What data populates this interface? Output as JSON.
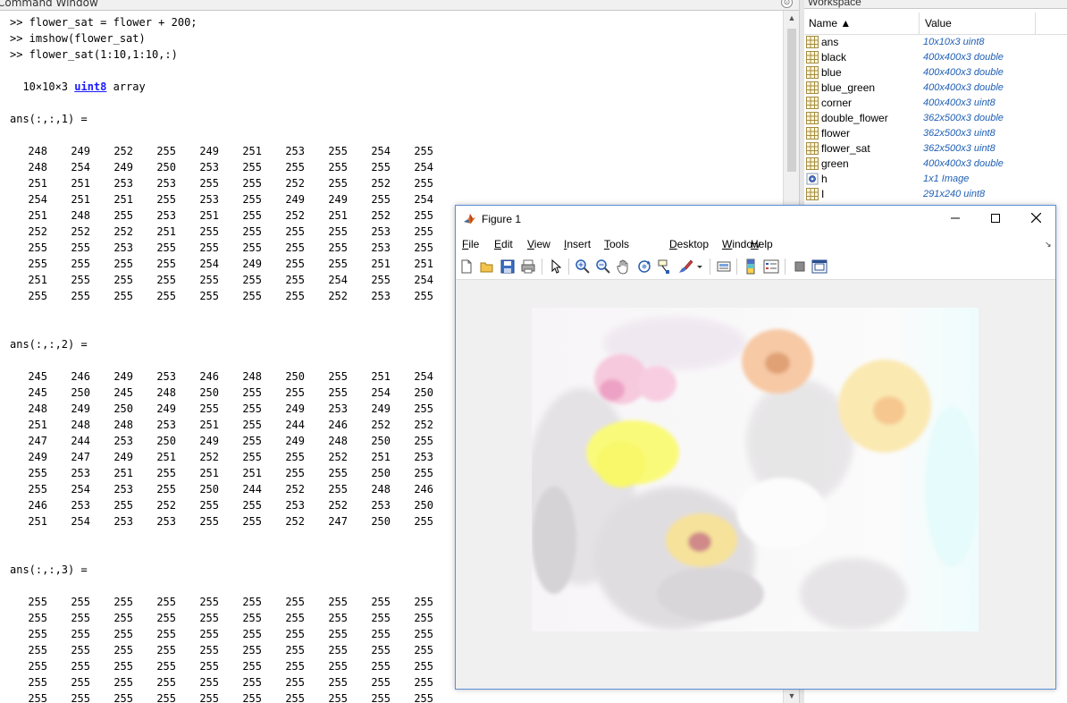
{
  "command_window": {
    "title": "Command Window",
    "commands": [
      ">> flower_sat = flower + 200;",
      ">> imshow(flower_sat)",
      ">> flower_sat(1:10,1:10,:)"
    ],
    "array_info": {
      "prefix": "  10×10×3 ",
      "class_link": "uint8",
      "suffix": " array"
    },
    "slices": [
      {
        "header": "ans(:,:,1) =",
        "rows": [
          [
            248,
            249,
            252,
            255,
            249,
            251,
            253,
            255,
            254,
            255
          ],
          [
            248,
            254,
            249,
            250,
            253,
            255,
            255,
            255,
            255,
            254
          ],
          [
            251,
            251,
            253,
            253,
            255,
            255,
            252,
            255,
            252,
            255
          ],
          [
            254,
            251,
            251,
            255,
            253,
            255,
            249,
            249,
            255,
            254
          ],
          [
            251,
            248,
            255,
            253,
            251,
            255,
            252,
            251,
            252,
            255
          ],
          [
            252,
            252,
            252,
            251,
            255,
            255,
            255,
            255,
            253,
            255
          ],
          [
            255,
            255,
            253,
            255,
            255,
            255,
            255,
            255,
            253,
            255
          ],
          [
            255,
            255,
            255,
            255,
            254,
            249,
            255,
            255,
            251,
            251
          ],
          [
            251,
            255,
            255,
            255,
            255,
            255,
            255,
            254,
            255,
            254
          ],
          [
            255,
            255,
            255,
            255,
            255,
            255,
            255,
            252,
            253,
            255
          ]
        ]
      },
      {
        "header": "ans(:,:,2) =",
        "rows": [
          [
            245,
            246,
            249,
            253,
            246,
            248,
            250,
            255,
            251,
            254
          ],
          [
            245,
            250,
            245,
            248,
            250,
            255,
            255,
            255,
            254,
            250
          ],
          [
            248,
            249,
            250,
            249,
            255,
            255,
            249,
            253,
            249,
            255
          ],
          [
            251,
            248,
            248,
            253,
            251,
            255,
            244,
            246,
            252,
            252
          ],
          [
            247,
            244,
            253,
            250,
            249,
            255,
            249,
            248,
            250,
            255
          ],
          [
            249,
            247,
            249,
            251,
            252,
            255,
            255,
            252,
            251,
            253
          ],
          [
            255,
            253,
            251,
            255,
            251,
            251,
            255,
            255,
            250,
            255
          ],
          [
            255,
            254,
            253,
            255,
            250,
            244,
            252,
            255,
            248,
            246
          ],
          [
            246,
            253,
            255,
            252,
            255,
            255,
            253,
            252,
            253,
            250
          ],
          [
            251,
            254,
            253,
            253,
            255,
            255,
            252,
            247,
            250,
            255
          ]
        ]
      },
      {
        "header": "ans(:,:,3) =",
        "rows": [
          [
            255,
            255,
            255,
            255,
            255,
            255,
            255,
            255,
            255,
            255
          ],
          [
            255,
            255,
            255,
            255,
            255,
            255,
            255,
            255,
            255,
            255
          ],
          [
            255,
            255,
            255,
            255,
            255,
            255,
            255,
            255,
            255,
            255
          ],
          [
            255,
            255,
            255,
            255,
            255,
            255,
            255,
            255,
            255,
            255
          ],
          [
            255,
            255,
            255,
            255,
            255,
            255,
            255,
            255,
            255,
            255
          ],
          [
            255,
            255,
            255,
            255,
            255,
            255,
            255,
            255,
            255,
            255
          ],
          [
            255,
            255,
            255,
            255,
            255,
            255,
            255,
            255,
            255,
            255
          ]
        ]
      }
    ]
  },
  "workspace": {
    "title": "Workspace",
    "columns": {
      "name": "Name ▲",
      "value": "Value"
    },
    "variables": [
      {
        "name": "ans",
        "value": "10x10x3 uint8",
        "icon": "grid-icon"
      },
      {
        "name": "black",
        "value": "400x400x3 double",
        "icon": "grid-icon"
      },
      {
        "name": "blue",
        "value": "400x400x3 double",
        "icon": "grid-icon"
      },
      {
        "name": "blue_green",
        "value": "400x400x3 double",
        "icon": "grid-icon"
      },
      {
        "name": "corner",
        "value": "400x400x3 uint8",
        "icon": "grid-icon"
      },
      {
        "name": "double_flower",
        "value": "362x500x3 double",
        "icon": "grid-icon"
      },
      {
        "name": "flower",
        "value": "362x500x3 uint8",
        "icon": "grid-icon"
      },
      {
        "name": "flower_sat",
        "value": "362x500x3 uint8",
        "icon": "grid-icon"
      },
      {
        "name": "green",
        "value": "400x400x3 double",
        "icon": "grid-icon"
      },
      {
        "name": "h",
        "value": "1x1 Image",
        "icon": "object-icon"
      },
      {
        "name": "I",
        "value": "291x240 uint8",
        "icon": "grid-icon"
      }
    ]
  },
  "figure": {
    "title": "Figure 1",
    "menu": [
      "File",
      "Edit",
      "View",
      "Insert",
      "Tools",
      "Desktop",
      "Window",
      "Help"
    ],
    "menu_mnemonics": [
      "F",
      "E",
      "V",
      "I",
      "T",
      "D",
      "W",
      "H"
    ],
    "toolbar": [
      "new-figure-icon",
      "open-file-icon",
      "save-icon",
      "print-icon",
      "pointer-icon",
      "zoom-in-icon",
      "zoom-out-icon",
      "pan-icon",
      "rotate-3d-icon",
      "data-cursor-icon",
      "brush-icon",
      "brush-dropdown-icon",
      "link-plot-icon",
      "colorbar-icon",
      "legend-icon",
      "hide-plot-tools-icon",
      "show-plot-tools-icon"
    ],
    "colors": {
      "accent": "#5b8fd6",
      "canvas": "#f0f0f0"
    }
  }
}
